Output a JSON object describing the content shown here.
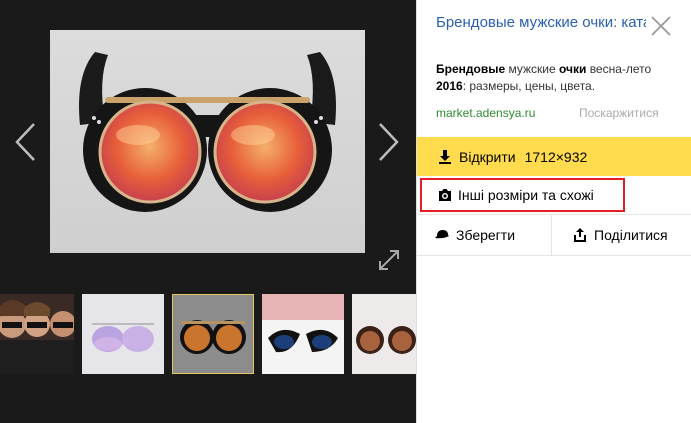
{
  "viewer": {
    "main_image_alt": "",
    "active_thumb_index": 2,
    "thumbs_count": 5
  },
  "panel": {
    "title": "Брендовые мужские очки: каталог товаров интернет-",
    "snippet": {
      "parts": [
        {
          "text": "Брендовые",
          "bold": true
        },
        {
          "text": " мужские ",
          "bold": false
        },
        {
          "text": "очки",
          "bold": true
        },
        {
          "text": " весна-лето ",
          "bold": false
        },
        {
          "text": "2016",
          "bold": true
        },
        {
          "text": ": размеры, цены, цвета.",
          "bold": false
        }
      ]
    },
    "source": "market.adensya.ru",
    "complain": "Поскаржитися",
    "open_label": "Відкрити",
    "resolution": "1712×932",
    "similar_label": "Інші розміри та схожі",
    "save_label": "Зберегти",
    "share_label": "Поділитися"
  },
  "colors": {
    "accent": "#ffdb4d",
    "link": "#2a5fb4",
    "source": "#2f8a2f",
    "highlight_border": "#e31e24",
    "viewer_bg": "#1a1a1a"
  },
  "icons": [
    "chevron-left-icon",
    "chevron-right-icon",
    "expand-icon",
    "close-icon",
    "download-icon",
    "camera-search-icon",
    "hat-icon",
    "share-icon"
  ]
}
